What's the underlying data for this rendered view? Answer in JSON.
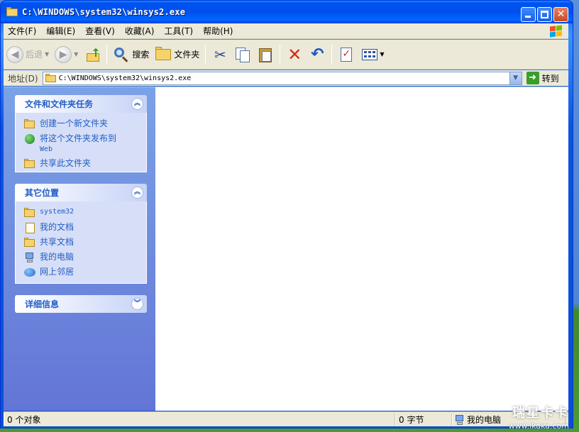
{
  "window": {
    "title": "C:\\WINDOWS\\system32\\winsys2.exe"
  },
  "menu": {
    "items": [
      "文件(F)",
      "编辑(E)",
      "查看(V)",
      "收藏(A)",
      "工具(T)",
      "帮助(H)"
    ]
  },
  "toolbar": {
    "back_label": "后退",
    "search_label": "搜索",
    "folders_label": "文件夹"
  },
  "address": {
    "label": "地址(D)",
    "value": "C:\\WINDOWS\\system32\\winsys2.exe",
    "go_label": "转到"
  },
  "sidebar": {
    "tasks": {
      "title": "文件和文件夹任务",
      "items": [
        "创建一个新文件夹",
        "将这个文件夹发布到",
        "Web",
        "共享此文件夹"
      ]
    },
    "places": {
      "title": "其它位置",
      "items": [
        "system32",
        "我的文档",
        "共享文档",
        "我的电脑",
        "网上邻居"
      ]
    },
    "details": {
      "title": "详细信息"
    }
  },
  "status": {
    "objects": "0 个对象",
    "size": "0 字节",
    "location": "我的电脑"
  },
  "watermark": {
    "logo": "瑞星卡卡",
    "site": "www.ikaka.com"
  },
  "colors": {
    "link": "#215dc6",
    "sidebar_top": "#7ba2e7",
    "sidebar_bottom": "#6375d6",
    "chrome": "#ece9d8",
    "titlebar": "#0050ee"
  }
}
